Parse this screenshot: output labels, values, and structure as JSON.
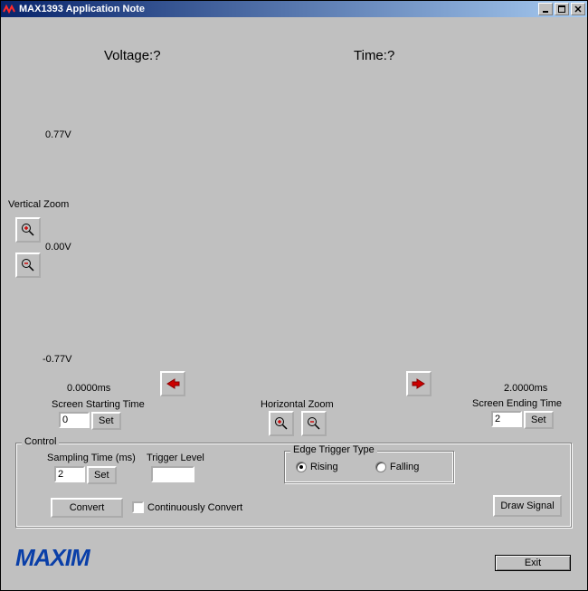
{
  "window": {
    "title": "MAX1393 Application Note"
  },
  "readout": {
    "voltage_label": "Voltage:",
    "voltage_value": "?",
    "time_label": "Time:",
    "time_value": "?"
  },
  "yaxis": {
    "top": "0.77V",
    "mid": "0.00V",
    "bottom": "-0.77V"
  },
  "xaxis": {
    "start_ms": "0.0000ms",
    "end_ms": "2.0000ms"
  },
  "vzoom": {
    "label": "Vertical Zoom"
  },
  "hzoom": {
    "label": "Horizontal Zoom"
  },
  "start_time": {
    "label": "Screen Starting Time",
    "value": "0",
    "set": "Set"
  },
  "end_time": {
    "label": "Screen Ending Time",
    "value": "2",
    "set": "Set"
  },
  "control": {
    "legend": "Control",
    "sampling": {
      "label": "Sampling Time (ms)",
      "value": "2",
      "set": "Set"
    },
    "trigger_level": {
      "label": "Trigger Level",
      "value": ""
    },
    "edge": {
      "legend": "Edge Trigger Type",
      "rising": "Rising",
      "falling": "Falling",
      "selected": "rising"
    },
    "convert": "Convert",
    "continuously": "Continuously Convert",
    "draw": "Draw Signal"
  },
  "footer": {
    "logo": "MAXIM",
    "exit": "Exit"
  }
}
